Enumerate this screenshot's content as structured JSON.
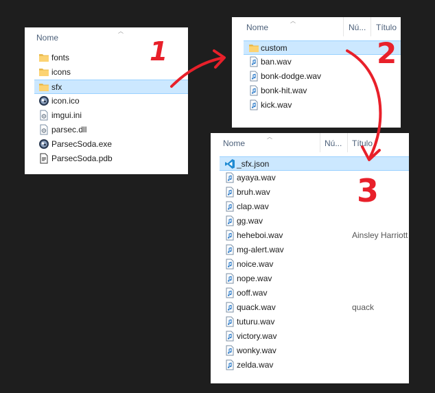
{
  "panel1": {
    "col_name": "Nome",
    "rows": [
      {
        "name": "fonts",
        "icon": "folder-icon"
      },
      {
        "name": "icons",
        "icon": "folder-icon"
      },
      {
        "name": "sfx",
        "icon": "folder-icon",
        "selected": true
      },
      {
        "name": "icon.ico",
        "icon": "app-icon"
      },
      {
        "name": "imgui.ini",
        "icon": "settings-file-icon"
      },
      {
        "name": "parsec.dll",
        "icon": "settings-file-icon"
      },
      {
        "name": "ParsecSoda.exe",
        "icon": "app-icon"
      },
      {
        "name": "ParsecSoda.pdb",
        "icon": "document-icon"
      }
    ]
  },
  "panel2": {
    "col_name": "Nome",
    "col_num": "Nú...",
    "col_title": "Título",
    "rows": [
      {
        "name": "custom",
        "icon": "folder-icon",
        "selected": true
      },
      {
        "name": "ban.wav",
        "icon": "audio-file-icon"
      },
      {
        "name": "bonk-dodge.wav",
        "icon": "audio-file-icon"
      },
      {
        "name": "bonk-hit.wav",
        "icon": "audio-file-icon"
      },
      {
        "name": "kick.wav",
        "icon": "audio-file-icon"
      }
    ]
  },
  "panel3": {
    "col_name": "Nome",
    "col_num": "Nú...",
    "col_title": "Título",
    "rows": [
      {
        "name": "_sfx.json",
        "icon": "vscode-icon",
        "selected": true,
        "title": ""
      },
      {
        "name": "ayaya.wav",
        "icon": "audio-file-icon",
        "title": ""
      },
      {
        "name": "bruh.wav",
        "icon": "audio-file-icon",
        "title": ""
      },
      {
        "name": "clap.wav",
        "icon": "audio-file-icon",
        "title": ""
      },
      {
        "name": "gg.wav",
        "icon": "audio-file-icon",
        "title": ""
      },
      {
        "name": "heheboi.wav",
        "icon": "audio-file-icon",
        "title": "Ainsley Harriott"
      },
      {
        "name": "mg-alert.wav",
        "icon": "audio-file-icon",
        "title": ""
      },
      {
        "name": "noice.wav",
        "icon": "audio-file-icon",
        "title": ""
      },
      {
        "name": "nope.wav",
        "icon": "audio-file-icon",
        "title": ""
      },
      {
        "name": "ooff.wav",
        "icon": "audio-file-icon",
        "title": ""
      },
      {
        "name": "quack.wav",
        "icon": "audio-file-icon",
        "title": "quack"
      },
      {
        "name": "tuturu.wav",
        "icon": "audio-file-icon",
        "title": ""
      },
      {
        "name": "victory.wav",
        "icon": "audio-file-icon",
        "title": ""
      },
      {
        "name": "wonky.wav",
        "icon": "audio-file-icon",
        "title": ""
      },
      {
        "name": "zelda.wav",
        "icon": "audio-file-icon",
        "title": ""
      }
    ]
  },
  "annotations": {
    "step1": "1",
    "step2": "2",
    "step3": "3",
    "color": "#e8202a"
  }
}
